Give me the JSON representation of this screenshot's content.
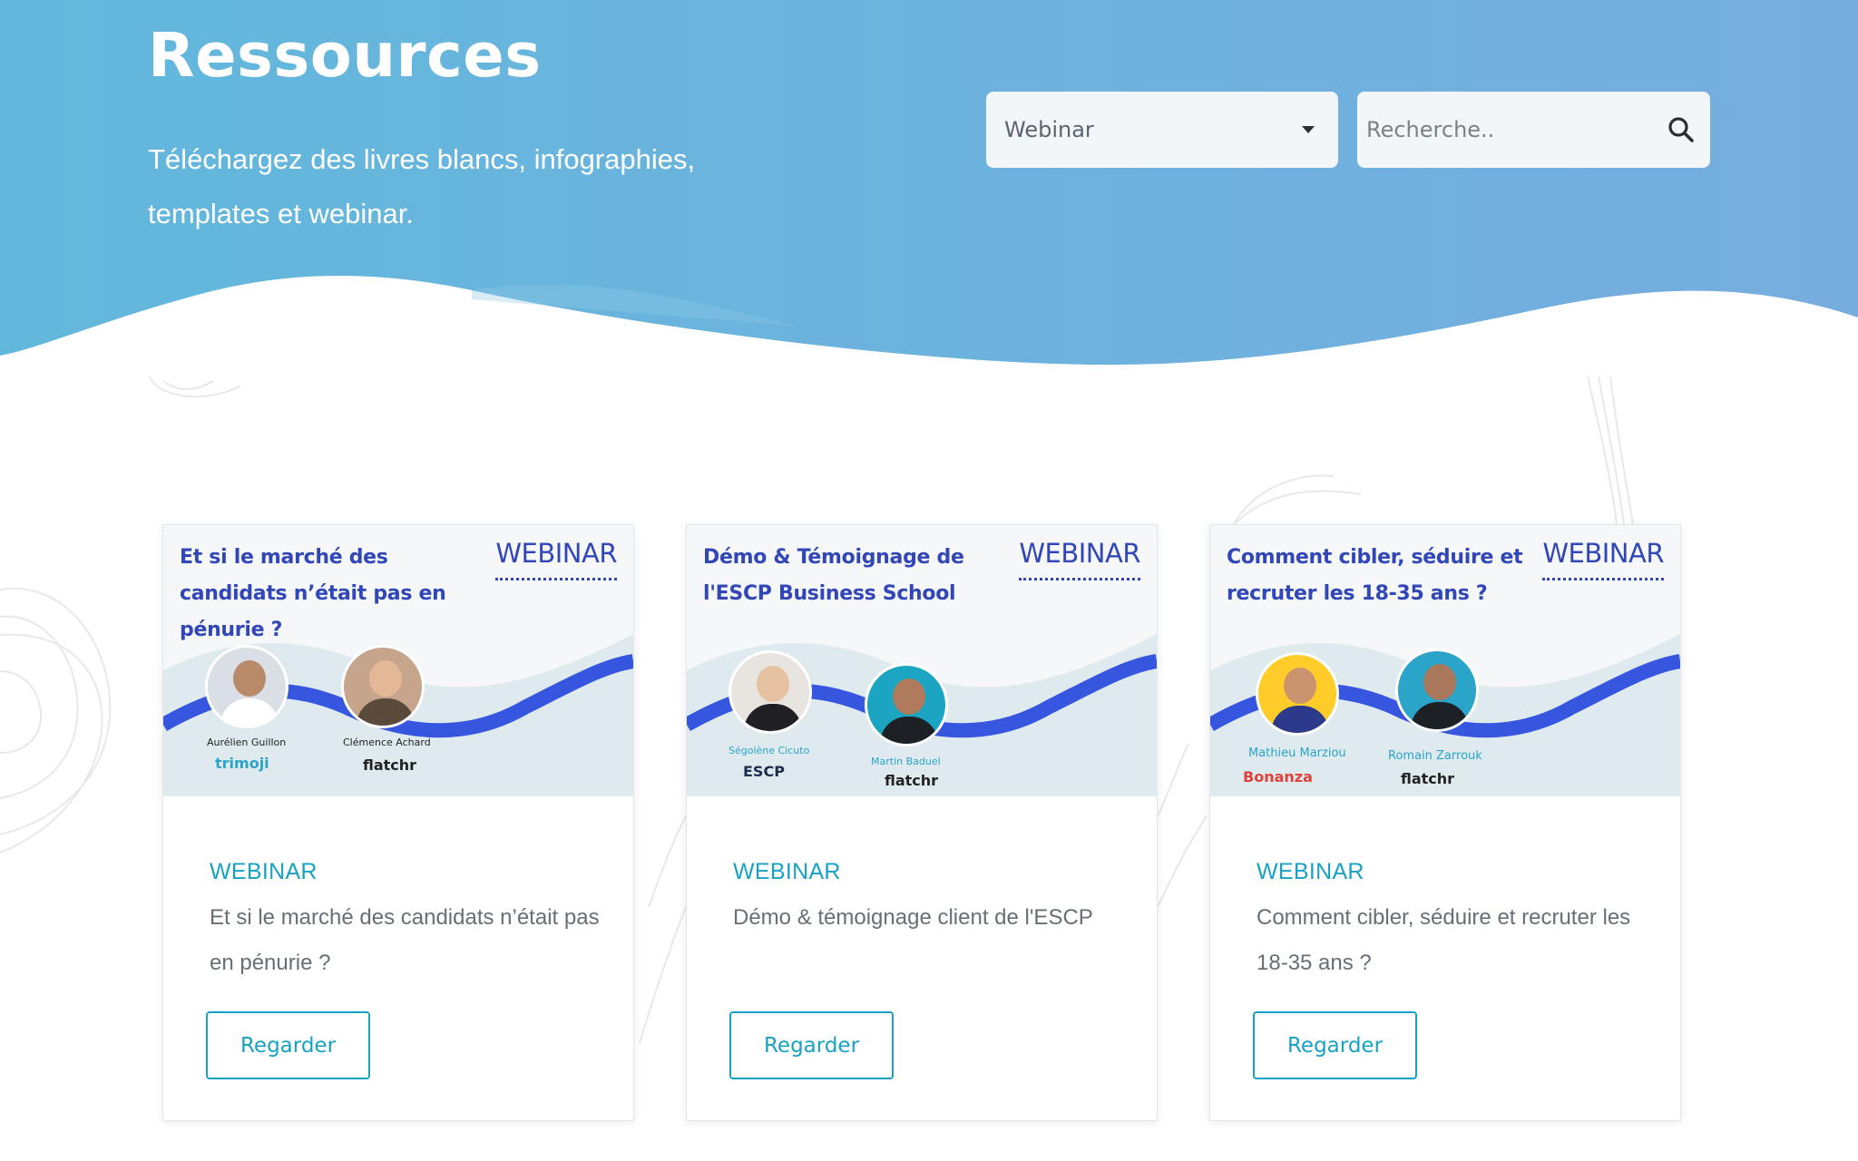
{
  "header": {
    "title": "Ressources",
    "subtitle": "Téléchargez des livres blancs, infographies, templates et webinar."
  },
  "filter": {
    "selected": "Webinar"
  },
  "search": {
    "placeholder": "Recherche.."
  },
  "colors": {
    "hero_start": "#62b8dc",
    "hero_end": "#76addf",
    "accent": "#17a2c4",
    "thumb_blue": "#3147b8"
  },
  "cards": [
    {
      "thumb_title": "Et si le marché des candidats n’était pas en pénurie ?",
      "thumb_tag": "WEBINAR",
      "speakers": [
        {
          "name": "Aurélien Guillon",
          "brand": "trimoji"
        },
        {
          "name": "Clémence Achard",
          "brand": "flatchr"
        }
      ],
      "label": "WEBINAR",
      "description": "Et si le marché des candidats n’était pas en pénurie ?",
      "button": "Regarder"
    },
    {
      "thumb_title": "Démo & Témoignage de l'ESCP Business School",
      "thumb_tag": "WEBINAR",
      "speakers": [
        {
          "name": "Ségolène Cicuto",
          "brand": "ESCP"
        },
        {
          "name": "Martin Baduel",
          "brand": "flatchr"
        }
      ],
      "label": "WEBINAR",
      "description": "Démo & témoignage client de l'ESCP",
      "button": "Regarder"
    },
    {
      "thumb_title": "Comment cibler, séduire et recruter les 18-35 ans ?",
      "thumb_tag": "WEBINAR",
      "speakers": [
        {
          "name": "Mathieu Marziou",
          "brand": "Bonanza"
        },
        {
          "name": "Romain Zarrouk",
          "brand": "flatchr"
        }
      ],
      "label": "WEBINAR",
      "description": "Comment cibler, séduire et recruter les 18-35 ans ?",
      "button": "Regarder"
    }
  ]
}
